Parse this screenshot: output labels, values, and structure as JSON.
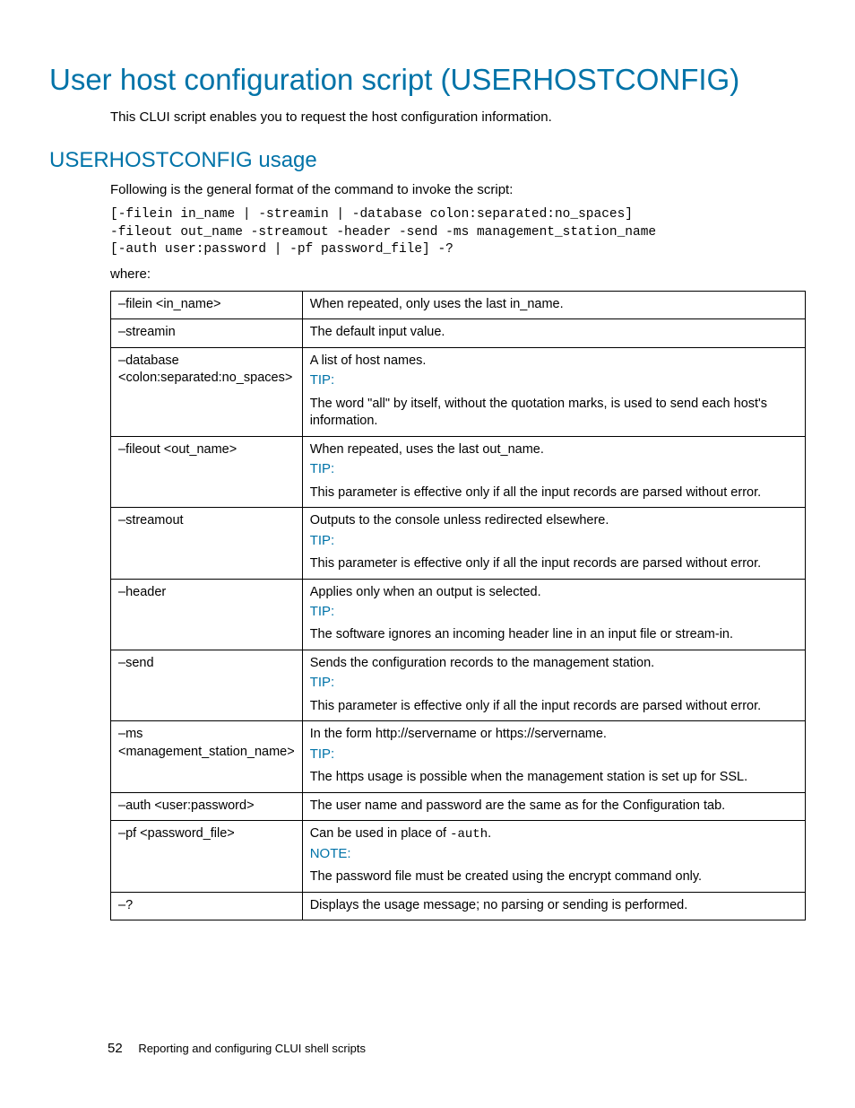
{
  "title": "User host configuration script (USERHOSTCONFIG)",
  "intro": "This CLUI script enables you to request the host configuration information.",
  "section_heading": "USERHOSTCONFIG usage",
  "usage_intro": "Following is the general format of the command to invoke the script:",
  "code": "[-filein in_name | -streamin | -database colon:separated:no_spaces]\n-fileout out_name -streamout -header -send -ms management_station_name\n[-auth user:password | -pf password_file] -?",
  "where": "where:",
  "tip_label": "TIP:",
  "note_label": "NOTE:",
  "rows": [
    {
      "opt": "–filein <in_name>",
      "desc": "When repeated, only uses the last in_name."
    },
    {
      "opt": "–streamin",
      "desc": "The default input value."
    },
    {
      "opt": "–database <colon:separated:no_spaces>",
      "desc": "A list of host names.",
      "callout": "TIP",
      "extra": "The word \"all\" by itself, without the quotation marks, is used to send each host's information."
    },
    {
      "opt": "–fileout <out_name>",
      "desc": "When repeated, uses the last out_name.",
      "callout": "TIP",
      "extra": "This parameter is effective only if all the input records are parsed without error."
    },
    {
      "opt": "–streamout",
      "desc": "Outputs to the console unless redirected elsewhere.",
      "callout": "TIP",
      "extra": "This parameter is effective only if all the input records are parsed without error."
    },
    {
      "opt": "–header",
      "desc": "Applies only when an output is selected.",
      "callout": "TIP",
      "extra": "The software ignores an incoming header line in an input file or stream-in."
    },
    {
      "opt": "–send",
      "desc": "Sends the configuration records to the management station.",
      "callout": "TIP",
      "extra": "This parameter is effective only if all the input records are parsed without error."
    },
    {
      "opt": "–ms <management_station_name>",
      "desc": "In the form http://servername or https://servername.",
      "callout": "TIP",
      "extra": "The https usage is possible when the management station is set up for SSL."
    },
    {
      "opt": "–auth <user:password>",
      "desc": "The user name and password are the same as for the Configuration tab."
    },
    {
      "opt": "–pf <password_file>",
      "desc_prefix": "Can be used in place of ",
      "desc_mono": "-auth",
      "desc_suffix": ".",
      "callout": "NOTE",
      "extra": "The password file must be created using the encrypt command only."
    },
    {
      "opt": "–?",
      "desc": "Displays the usage message; no parsing or sending is performed."
    }
  ],
  "footer": {
    "page": "52",
    "chapter": "Reporting and configuring CLUI shell scripts"
  }
}
